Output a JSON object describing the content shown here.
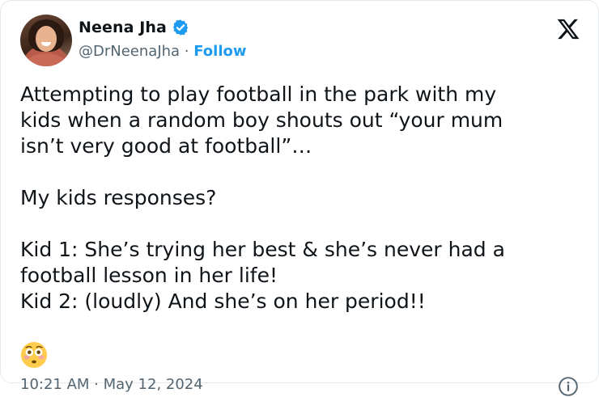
{
  "author": {
    "name": "Neena Jha",
    "handle": "@DrNeenaJha",
    "separator": " · ",
    "follow_label": "Follow",
    "verified_color": "#1d9bf0"
  },
  "brand": {
    "logo_icon": "x-logo-icon"
  },
  "tweet": {
    "text": "Attempting to play football in the park with my\nkids when a random boy shouts out “your mum\nisn’t very good at football”…\n\nMy kids responses?\n\nKid 1: She’s trying her best & she’s never had a\nfootball lesson in her life!\nKid 2: (loudly) And she’s on her period!!",
    "emoji": "flushed-face-emoji",
    "timestamp": "10:21 AM · May 12, 2024"
  },
  "colors": {
    "accent": "#1d9bf0",
    "secondary_text": "#536471",
    "text": "#0f1419"
  }
}
